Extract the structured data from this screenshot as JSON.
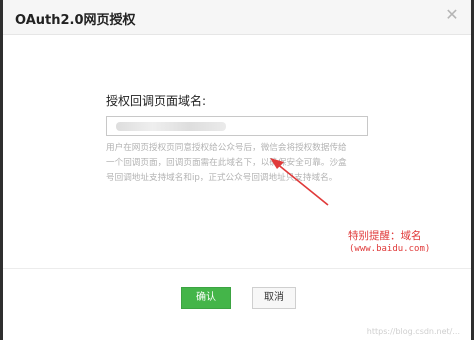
{
  "dialog": {
    "title": "OAuth2.0网页授权",
    "close_glyph": "✕"
  },
  "form": {
    "label": "授权回调页面域名:",
    "input_value": "",
    "help_line1": "用户在网页授权页同意授权给公众号后，微信会将授权数据传给",
    "help_line2": "一个回调页面，回调页面需在此域名下，以确保安全可靠。沙盒",
    "help_line3": "号回调地址支持域名和ip，正式公众号回调地址只支持域名。"
  },
  "annotation": {
    "line1": "特别提醒：域名",
    "line2": "(www.baidu.com)",
    "color": "#e03a3a"
  },
  "buttons": {
    "confirm": "确认",
    "cancel": "取消",
    "confirm_color": "#44b549"
  },
  "watermark": "https://blog.csdn.net/...",
  "icons": [
    "close-icon",
    "arrow-annotation"
  ]
}
